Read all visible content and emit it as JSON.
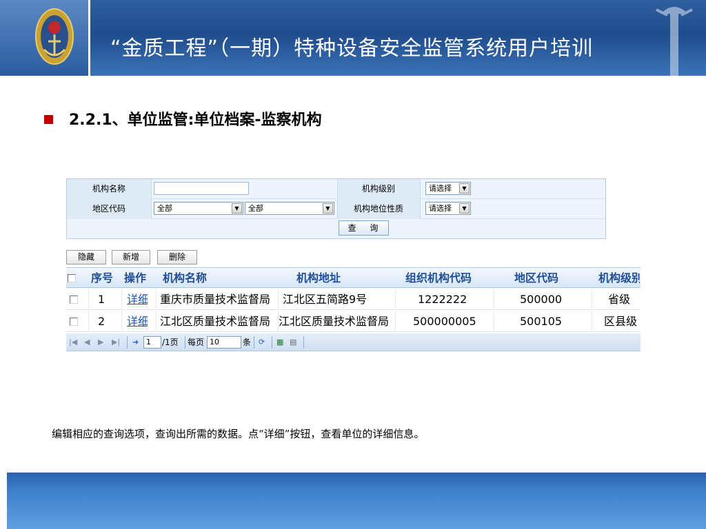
{
  "header": {
    "title": "“金质工程”（一期）特种设备安全监管系统用户培训"
  },
  "section": {
    "title": "2.2.1、单位监管:单位档案-监察机构"
  },
  "form": {
    "org_name_label": "机构名称",
    "org_name_value": "",
    "org_level_label": "机构级别",
    "org_level_value": "请选择",
    "region_code_label": "地区代码",
    "region_select_1": "全部",
    "region_select_2": "全部",
    "org_status_label": "机构地位性质",
    "org_status_value": "请选择",
    "query_button": "查 询"
  },
  "toolbar": {
    "hide_label": "隐藏",
    "add_label": "新增",
    "delete_label": "删除"
  },
  "grid": {
    "columns": [
      "序号",
      "操作",
      "机构名称",
      "机构地址",
      "组织机构代码",
      "地区代码",
      "机构级别"
    ],
    "rows": [
      {
        "index": "1",
        "action": "详细",
        "name": "重庆市质量技术监督局",
        "address": "江北区五简路9号",
        "org_code": "1222222",
        "region_code": "500000",
        "level": "省级"
      },
      {
        "index": "2",
        "action": "详细",
        "name": "江北区质量技术监督局",
        "address": "江北区质量技术监督局",
        "org_code": "500000005",
        "region_code": "500105",
        "level": "区县级"
      }
    ]
  },
  "pager": {
    "page_value": "1",
    "page_total": "/1页",
    "per_page_label": "每页",
    "per_page_value": "10",
    "per_page_unit": "条"
  },
  "caption": "编辑相应的查询选项，查询出所需的数据。点“详细”按钮，查看单位的详细信息。"
}
